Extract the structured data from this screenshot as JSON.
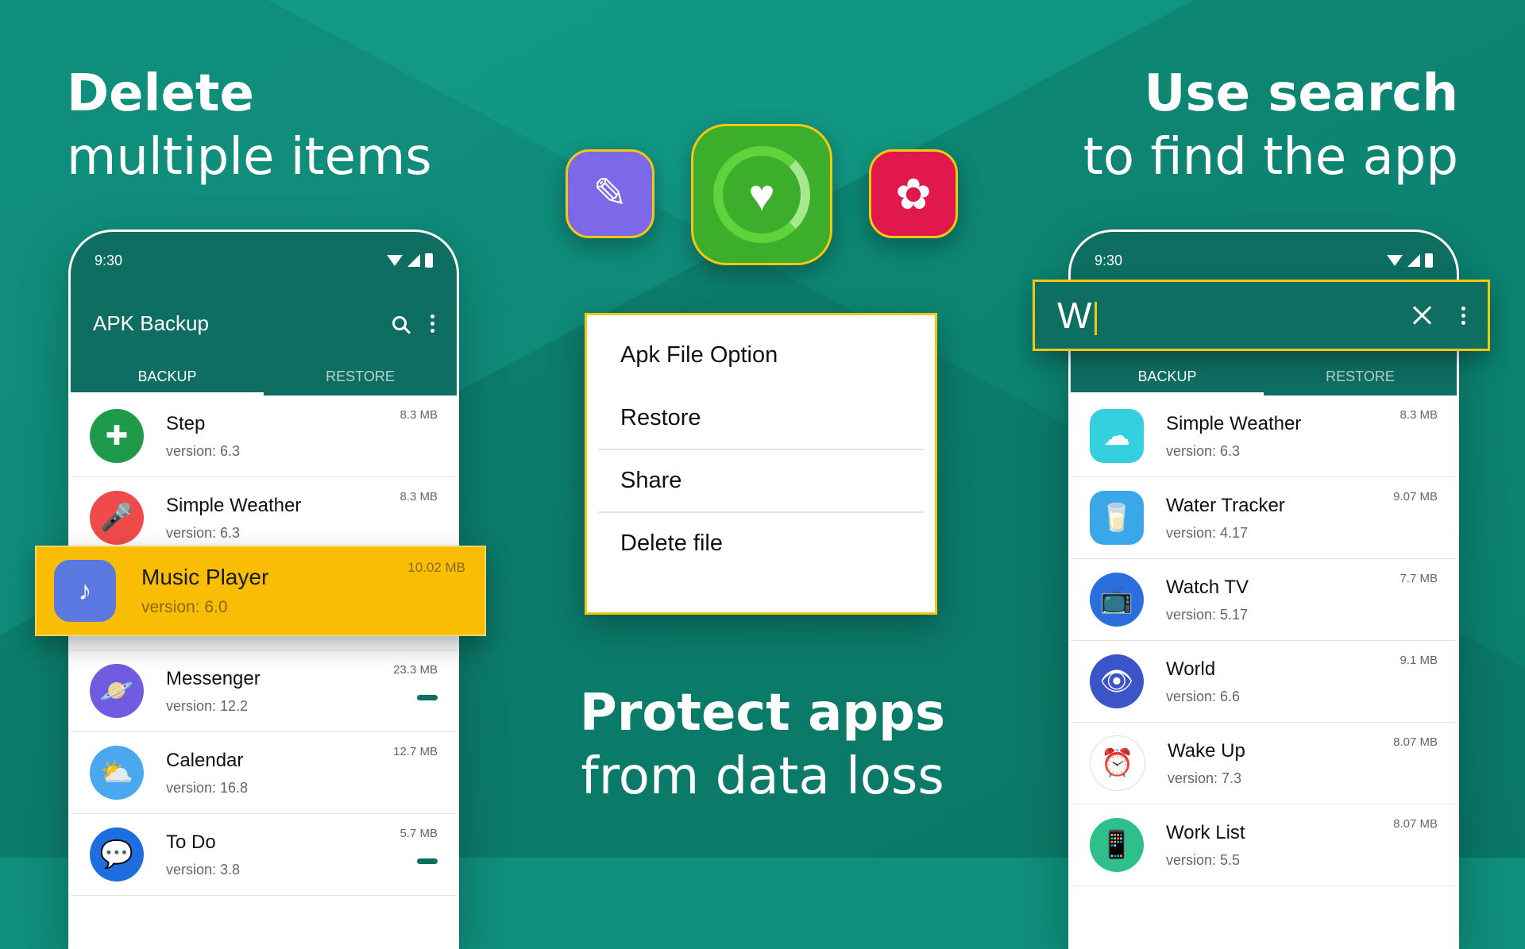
{
  "headlines": {
    "left": {
      "bold": "Delete",
      "regular": "multiple items"
    },
    "right": {
      "bold": "Use search",
      "regular": "to find the app"
    },
    "center": {
      "bold": "Protect apps",
      "regular": "from data loss"
    }
  },
  "left_phone": {
    "time": "9:30",
    "app_title": "APK Backup",
    "tabs": [
      "BACKUP",
      "RESTORE"
    ],
    "rows": [
      {
        "name": "Step",
        "version": "version: 6.3",
        "size": "8.3 MB",
        "icon": "accessibility-icon",
        "color": "#1f9a4a"
      },
      {
        "name": "Simple Weather",
        "version": "version: 6.3",
        "size": "8.3 MB",
        "icon": "microphone-icon",
        "color": "#ef4b4b"
      },
      {
        "name": "Messenger",
        "version": "version: 12.2",
        "size": "23.3 MB",
        "icon": "planet-icon",
        "color": "#6f5ce0"
      },
      {
        "name": "Calendar",
        "version": "version: 16.8",
        "size": "12.7 MB",
        "icon": "sun-cloud-icon",
        "color": "#4aa8f0"
      },
      {
        "name": "To Do",
        "version": "version: 3.8",
        "size": "5.7 MB",
        "icon": "chat-icon",
        "color": "#1f6ee0"
      }
    ],
    "highlight": {
      "name": "Music Player",
      "version": "version: 6.0",
      "size": "10.02 MB",
      "icon": "music-note-icon",
      "color": "#5b78e0"
    }
  },
  "menu": {
    "title": "Apk File Option",
    "items": [
      "Restore",
      "Share",
      "Delete file"
    ]
  },
  "right_phone": {
    "time": "9:30",
    "search_value": "W",
    "tabs": [
      "BACKUP",
      "RESTORE"
    ],
    "rows": [
      {
        "name": "Simple Weather",
        "version": "version: 6.3",
        "size": "8.3 MB",
        "icon": "cloud-icon",
        "color": "#34d0e0"
      },
      {
        "name": "Water Tracker",
        "version": "version: 4.17",
        "size": "9.07 MB",
        "icon": "glass-icon",
        "color": "#3aa8e8"
      },
      {
        "name": "Watch TV",
        "version": "version: 5.17",
        "size": "7.7 MB",
        "icon": "tv-icon",
        "color": "#2b6ee0"
      },
      {
        "name": "World",
        "version": "version: 6.6",
        "size": "9.1 MB",
        "icon": "eye-icon",
        "color": "#3b54c8"
      },
      {
        "name": "Wake Up",
        "version": "version: 7.3",
        "size": "8.07 MB",
        "icon": "clock-icon",
        "color": "#ffffff"
      },
      {
        "name": "Work List",
        "version": "version: 5.5",
        "size": "8.07 MB",
        "icon": "phone-hand-icon",
        "color": "#2fbf8a"
      }
    ]
  },
  "badges": [
    {
      "icon": "pencil-icon",
      "color": "#7c68e8"
    },
    {
      "icon": "heart-icon",
      "color": "#3dae2c"
    },
    {
      "icon": "flower-icon",
      "color": "#e0184c"
    }
  ]
}
